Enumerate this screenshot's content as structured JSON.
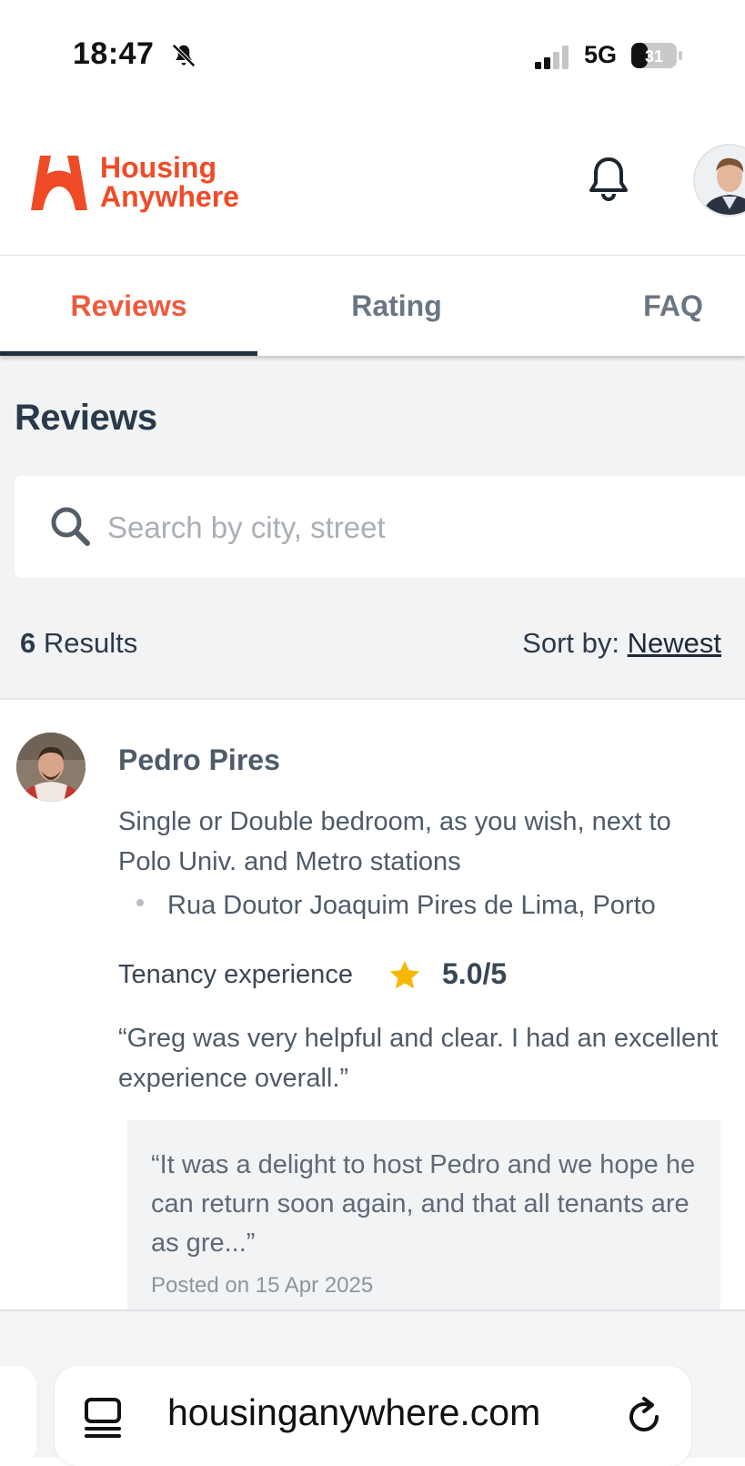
{
  "status_bar": {
    "time": "18:47",
    "network": "5G",
    "battery": "31"
  },
  "header": {
    "brand_line1": "Housing",
    "brand_line2": "Anywhere"
  },
  "tabs": [
    {
      "label": "Reviews",
      "active": true
    },
    {
      "label": "Rating",
      "active": false
    },
    {
      "label": "FAQ",
      "active": false
    }
  ],
  "main": {
    "title": "Reviews",
    "search": {
      "placeholder": "Search by city, street",
      "value": ""
    },
    "results_count": "6",
    "results_label": "Results",
    "sort_label": "Sort by:",
    "sort_value": "Newest"
  },
  "review": {
    "reviewer": "Pedro Pires",
    "listing_title": "Single or Double bedroom, as you wish, next to Polo Univ. and Metro stations",
    "address": "Rua Doutor Joaquim Pires de Lima, Porto",
    "tenancy_label": "Tenancy experience",
    "score": "5.0/5",
    "quote": "“Greg was very helpful and clear. I had an excellent experience overall.”",
    "host_reply": "“It was a delight to host Pedro and we hope he can return soon again, and that all tenants are as gre...”",
    "posted": "Posted on 15 Apr 2025"
  },
  "browser": {
    "url": "housinganywhere.com"
  },
  "colors": {
    "brand": "#ef4b27",
    "star": "#f5b800",
    "tab_underline": "#1f2f3d"
  },
  "icons": [
    "bell-off-icon",
    "signal-icon",
    "battery-icon",
    "logo-icon",
    "notification-bell-icon",
    "avatar",
    "search-icon",
    "star-icon",
    "reader-icon",
    "reload-icon"
  ]
}
